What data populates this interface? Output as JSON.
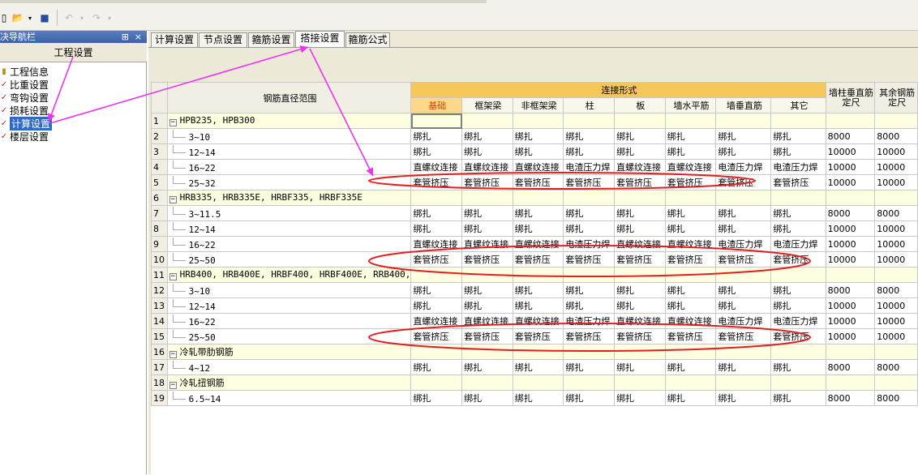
{
  "nav": {
    "header": "决导航栏",
    "pin": "⊞",
    "close": "×",
    "section": "工程设置",
    "items": [
      {
        "label": "工程信息",
        "icon": "info-icon",
        "selected": false
      },
      {
        "label": "比重设置",
        "icon": "settings-icon",
        "selected": false
      },
      {
        "label": "弯钩设置",
        "icon": "settings-icon",
        "selected": false
      },
      {
        "label": "损耗设置",
        "icon": "settings-icon",
        "selected": false
      },
      {
        "label": "计算设置",
        "icon": "settings-icon",
        "selected": true
      },
      {
        "label": "楼层设置",
        "icon": "settings-icon",
        "selected": false
      }
    ]
  },
  "tabs": [
    {
      "label": "计算设置",
      "active": false
    },
    {
      "label": "节点设置",
      "active": false
    },
    {
      "label": "箍筋设置",
      "active": false
    },
    {
      "label": "搭接设置",
      "active": true
    },
    {
      "label": "箍筋公式",
      "active": false
    }
  ],
  "grid": {
    "header_range": "钢筋直径范围",
    "header_group": "连接形式",
    "header_wall_vertical": "墙柱垂直筋定尺",
    "header_other": "其余钢筋定尺",
    "columns": [
      "基础",
      "框架梁",
      "非框架梁",
      "柱",
      "板",
      "墙水平筋",
      "墙垂直筋",
      "其它"
    ],
    "rows": [
      {
        "n": "1",
        "group": true,
        "label": "HPB235, HPB300",
        "cells": []
      },
      {
        "n": "2",
        "label": "3~10",
        "cells": [
          "绑扎",
          "绑扎",
          "绑扎",
          "绑扎",
          "绑扎",
          "绑扎",
          "绑扎",
          "绑扎"
        ],
        "a": "8000",
        "b": "8000"
      },
      {
        "n": "3",
        "label": "12~14",
        "cells": [
          "绑扎",
          "绑扎",
          "绑扎",
          "绑扎",
          "绑扎",
          "绑扎",
          "绑扎",
          "绑扎"
        ],
        "a": "10000",
        "b": "10000"
      },
      {
        "n": "4",
        "label": "16~22",
        "cells": [
          "直螺纹连接",
          "直螺纹连接",
          "直螺纹连接",
          "电渣压力焊",
          "直螺纹连接",
          "直螺纹连接",
          "电渣压力焊",
          "电渣压力焊"
        ],
        "a": "10000",
        "b": "10000"
      },
      {
        "n": "5",
        "label": "25~32",
        "cells": [
          "套管挤压",
          "套管挤压",
          "套管挤压",
          "套管挤压",
          "套管挤压",
          "套管挤压",
          "套管挤压",
          "套管挤压"
        ],
        "a": "10000",
        "b": "10000"
      },
      {
        "n": "6",
        "group": true,
        "label": "HRB335, HRB335E, HRBF335, HRBF335E",
        "cells": []
      },
      {
        "n": "7",
        "label": "3~11.5",
        "cells": [
          "绑扎",
          "绑扎",
          "绑扎",
          "绑扎",
          "绑扎",
          "绑扎",
          "绑扎",
          "绑扎"
        ],
        "a": "8000",
        "b": "8000"
      },
      {
        "n": "8",
        "label": "12~14",
        "cells": [
          "绑扎",
          "绑扎",
          "绑扎",
          "绑扎",
          "绑扎",
          "绑扎",
          "绑扎",
          "绑扎"
        ],
        "a": "10000",
        "b": "10000"
      },
      {
        "n": "9",
        "label": "16~22",
        "cells": [
          "直螺纹连接",
          "直螺纹连接",
          "直螺纹连接",
          "电渣压力焊",
          "直螺纹连接",
          "直螺纹连接",
          "电渣压力焊",
          "电渣压力焊"
        ],
        "a": "10000",
        "b": "10000"
      },
      {
        "n": "10",
        "label": "25~50",
        "cells": [
          "套管挤压",
          "套管挤压",
          "套管挤压",
          "套管挤压",
          "套管挤压",
          "套管挤压",
          "套管挤压",
          "套管挤压"
        ],
        "a": "10000",
        "b": "10000"
      },
      {
        "n": "11",
        "group": true,
        "label": "HRB400, HRB400E, HRBF400, HRBF400E, RRB400,",
        "cells": []
      },
      {
        "n": "12",
        "label": "3~10",
        "cells": [
          "绑扎",
          "绑扎",
          "绑扎",
          "绑扎",
          "绑扎",
          "绑扎",
          "绑扎",
          "绑扎"
        ],
        "a": "8000",
        "b": "8000"
      },
      {
        "n": "13",
        "label": "12~14",
        "cells": [
          "绑扎",
          "绑扎",
          "绑扎",
          "绑扎",
          "绑扎",
          "绑扎",
          "绑扎",
          "绑扎"
        ],
        "a": "10000",
        "b": "10000"
      },
      {
        "n": "14",
        "label": "16~22",
        "cells": [
          "直螺纹连接",
          "直螺纹连接",
          "直螺纹连接",
          "电渣压力焊",
          "直螺纹连接",
          "直螺纹连接",
          "电渣压力焊",
          "电渣压力焊"
        ],
        "a": "10000",
        "b": "10000"
      },
      {
        "n": "15",
        "label": "25~50",
        "cells": [
          "套管挤压",
          "套管挤压",
          "套管挤压",
          "套管挤压",
          "套管挤压",
          "套管挤压",
          "套管挤压",
          "套管挤压"
        ],
        "a": "10000",
        "b": "10000"
      },
      {
        "n": "16",
        "group": true,
        "label": "冷轧带肋钢筋",
        "cells": []
      },
      {
        "n": "17",
        "label": "4~12",
        "cells": [
          "绑扎",
          "绑扎",
          "绑扎",
          "绑扎",
          "绑扎",
          "绑扎",
          "绑扎",
          "绑扎"
        ],
        "a": "8000",
        "b": "8000"
      },
      {
        "n": "18",
        "group": true,
        "label": "冷轧扭钢筋",
        "cells": []
      },
      {
        "n": "19",
        "label": "6.5~14",
        "cells": [
          "绑扎",
          "绑扎",
          "绑扎",
          "绑扎",
          "绑扎",
          "绑扎",
          "绑扎",
          "绑扎"
        ],
        "a": "8000",
        "b": "8000"
      }
    ]
  },
  "colors": {
    "annotation_arrow": "#ee33ee",
    "annotation_ellipse": "#e02020",
    "header_group": "#f5c65a"
  }
}
